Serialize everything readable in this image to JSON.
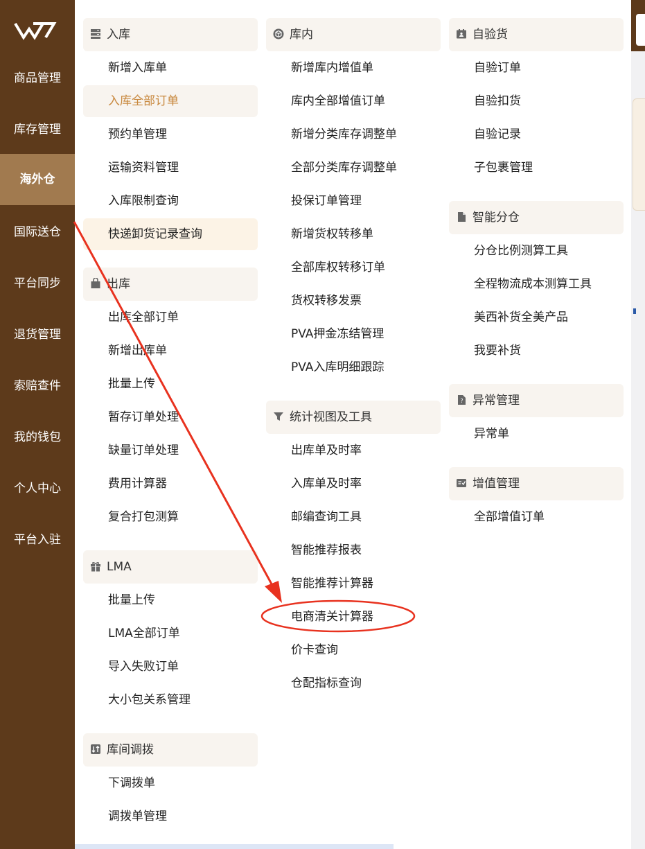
{
  "sidebar": {
    "logo_label": "W",
    "items": [
      {
        "label": "商品管理"
      },
      {
        "label": "库存管理"
      },
      {
        "label": "海外仓"
      },
      {
        "label": "国际送仓"
      },
      {
        "label": "平台同步"
      },
      {
        "label": "退货管理"
      },
      {
        "label": "索赔查件"
      },
      {
        "label": "我的钱包"
      },
      {
        "label": "个人中心"
      },
      {
        "label": "平台入驻"
      }
    ]
  },
  "columns": {
    "col1": {
      "inbound": {
        "title": "入库",
        "icon": "server-icon",
        "items": [
          "新增入库单",
          "入库全部订单",
          "预约单管理",
          "运输资料管理",
          "入库限制查询",
          "快递卸货记录查询"
        ]
      },
      "outbound": {
        "title": "出库",
        "icon": "bag-icon",
        "items": [
          "出库全部订单",
          "新增出库单",
          "批量上传",
          "暂存订单处理",
          "缺量订单处理",
          "费用计算器",
          "复合打包测算"
        ]
      },
      "lma": {
        "title": "LMA",
        "icon": "gift-icon",
        "items": [
          "批量上传",
          "LMA全部订单",
          "导入失败订单",
          "大小包关系管理"
        ]
      },
      "transfer": {
        "title": "库间调拨",
        "icon": "transfer-icon",
        "items": [
          "下调拨单",
          "调拨单管理"
        ]
      }
    },
    "col2": {
      "warehouse": {
        "title": "库内",
        "icon": "box-icon",
        "items": [
          "新增库内增值单",
          "库内全部增值订单",
          "新增分类库存调整单",
          "全部分类库存调整单",
          "投保订单管理",
          "新增货权转移单",
          "全部库权转移订单",
          "货权转移发票",
          "PVA押金冻结管理",
          "PVA入库明细跟踪"
        ]
      },
      "stats": {
        "title": "统计视图及工具",
        "icon": "funnel-icon",
        "items": [
          "出库单及时率",
          "入库单及时率",
          "邮编查询工具",
          "智能推荐报表",
          "智能推荐计算器",
          "电商清关计算器",
          "价卡查询",
          "仓配指标查询"
        ]
      }
    },
    "col3": {
      "selfcheck": {
        "title": "自验货",
        "icon": "id-card-icon",
        "items": [
          "自验订单",
          "自验扣货",
          "自验记录",
          "子包裹管理"
        ]
      },
      "smart": {
        "title": "智能分仓",
        "icon": "document-icon",
        "items": [
          "分仓比例测算工具",
          "全程物流成本测算工具",
          "美西补货全美产品",
          "我要补货"
        ]
      },
      "exception": {
        "title": "异常管理",
        "icon": "question-doc-icon",
        "items": [
          "异常单"
        ]
      },
      "valueadd": {
        "title": "增值管理",
        "icon": "check-card-icon",
        "items": [
          "全部增值订单"
        ]
      }
    }
  },
  "colors": {
    "sidebar_bg": "#5d3a1b",
    "sidebar_active": "#a17a4f",
    "selected_text": "#c8883e",
    "header_bg": "#f8f4ef",
    "annotation": "#e8321f"
  }
}
